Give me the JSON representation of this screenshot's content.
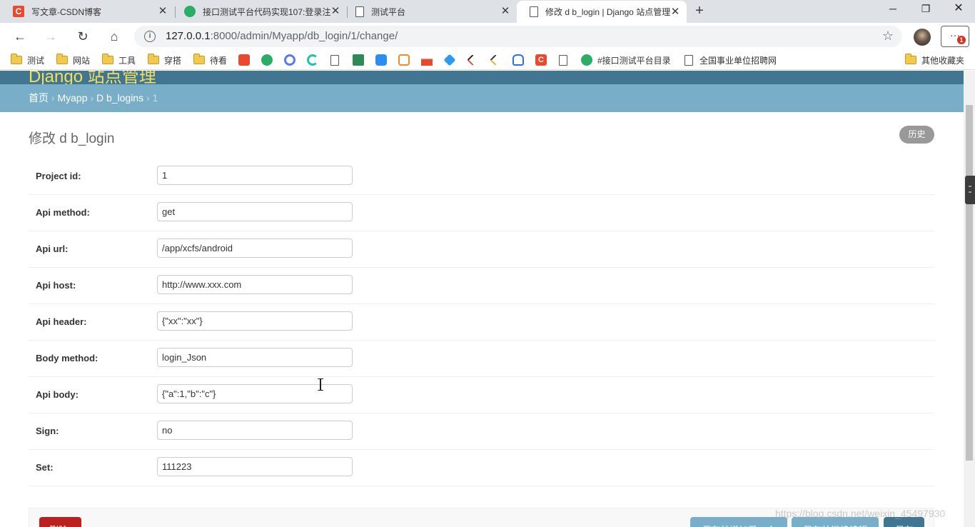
{
  "browser": {
    "tabs": [
      {
        "title": "写文章-CSDN博客",
        "icon": "csdn-icon"
      },
      {
        "title": "接口测试平台代码实现107:登录注",
        "icon": "wechat-icon"
      },
      {
        "title": "测试平台",
        "icon": "page-icon"
      },
      {
        "title": "修改 d b_login | Django 站点管理",
        "icon": "page-icon",
        "active": true
      }
    ],
    "url_host": "127.0.0.1",
    "url_rest": ":8000/admin/Myapp/db_login/1/change/",
    "menu_badge": "1",
    "bookmarks": [
      {
        "label": "测试",
        "type": "folder"
      },
      {
        "label": "网站",
        "type": "folder"
      },
      {
        "label": "工具",
        "type": "folder"
      },
      {
        "label": "穿搭",
        "type": "folder"
      },
      {
        "label": "待看",
        "type": "folder"
      },
      {
        "label": "#接口测试平台目录",
        "type": "wechat"
      },
      {
        "label": "全国事业单位招聘网",
        "type": "page"
      },
      {
        "label": "其他收藏夹",
        "type": "folder"
      }
    ]
  },
  "admin": {
    "branding": "Django 站点管理",
    "breadcrumbs": {
      "home": "首页",
      "app": "Myapp",
      "model": "D b_logins",
      "current": "1",
      "sep": "›"
    },
    "title": "修改 d b_login",
    "history": "历史",
    "fields": [
      {
        "label": "Project id:",
        "value": "1"
      },
      {
        "label": "Api method:",
        "value": "get"
      },
      {
        "label": "Api url:",
        "value": "/app/xcfs/android"
      },
      {
        "label": "Api host:",
        "value": "http://www.xxx.com"
      },
      {
        "label": "Api header:",
        "value": "{\"xx\":\"xx\"}"
      },
      {
        "label": "Body method:",
        "value": "login_Json"
      },
      {
        "label": "Api body:",
        "value": "{\"a\":1,\"b\":\"c\"}"
      },
      {
        "label": "Sign:",
        "value": "no"
      },
      {
        "label": "Set:",
        "value": "111223"
      }
    ],
    "actions": {
      "delete": "删除",
      "save_add": "保存并增加另一个",
      "save_continue": "保存并继续编辑",
      "save": "保存"
    }
  },
  "watermark": "https://blog.csdn.net/weixin_45497930",
  "colors": {
    "header": "#417690",
    "breadcrumbs": "#79aec8",
    "delete": "#ba2121",
    "branding": "#f5dd5d"
  }
}
